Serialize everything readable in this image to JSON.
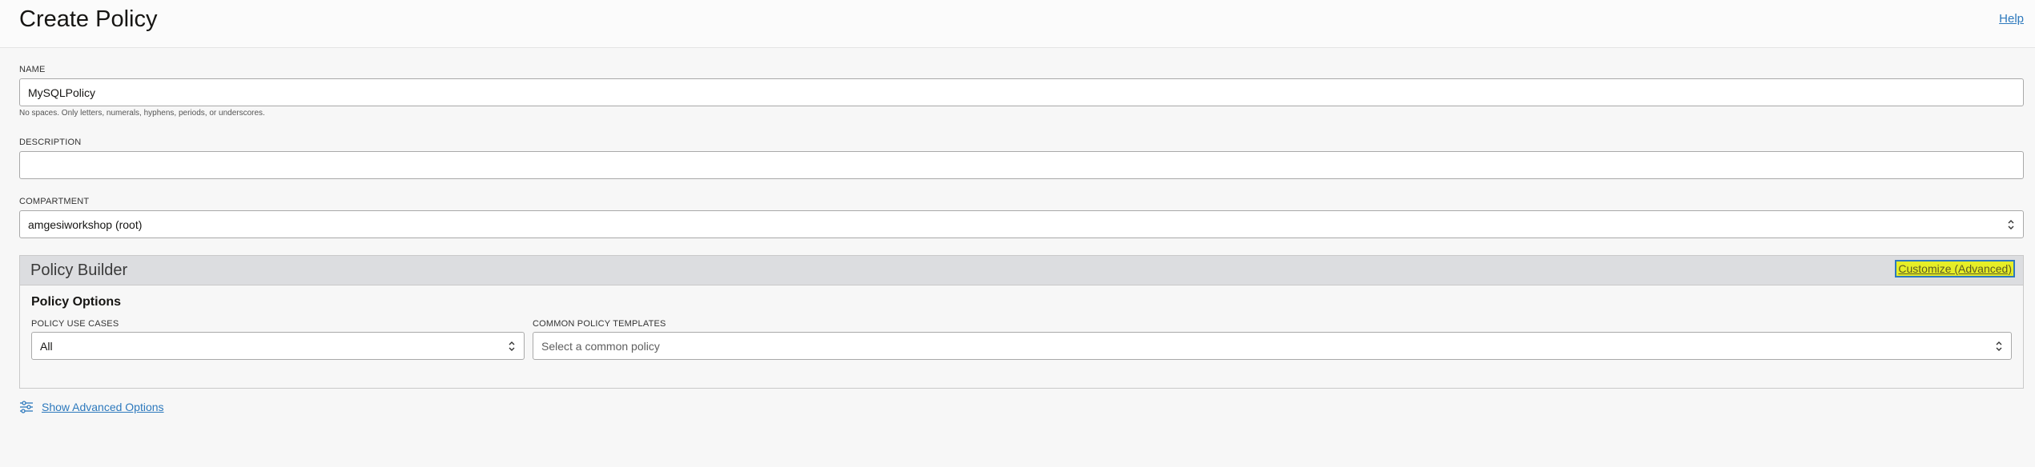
{
  "header": {
    "title": "Create Policy",
    "help_label": "Help"
  },
  "form": {
    "name": {
      "label": "NAME",
      "value": "MySQLPolicy",
      "hint": "No spaces. Only letters, numerals, hyphens, periods, or underscores."
    },
    "description": {
      "label": "DESCRIPTION",
      "value": ""
    },
    "compartment": {
      "label": "COMPARTMENT",
      "value": "amgesiworkshop (root)"
    }
  },
  "policy_builder": {
    "title": "Policy Builder",
    "customize_label": "Customize (Advanced)",
    "options_title": "Policy Options",
    "use_cases": {
      "label": "POLICY USE CASES",
      "value": "All"
    },
    "templates": {
      "label": "COMMON POLICY TEMPLATES",
      "placeholder": "Select a common policy"
    }
  },
  "advanced": {
    "label": "Show Advanced Options",
    "icon": "sliders-icon"
  },
  "colors": {
    "link": "#2d79bd",
    "highlight": "#e6ee27"
  }
}
